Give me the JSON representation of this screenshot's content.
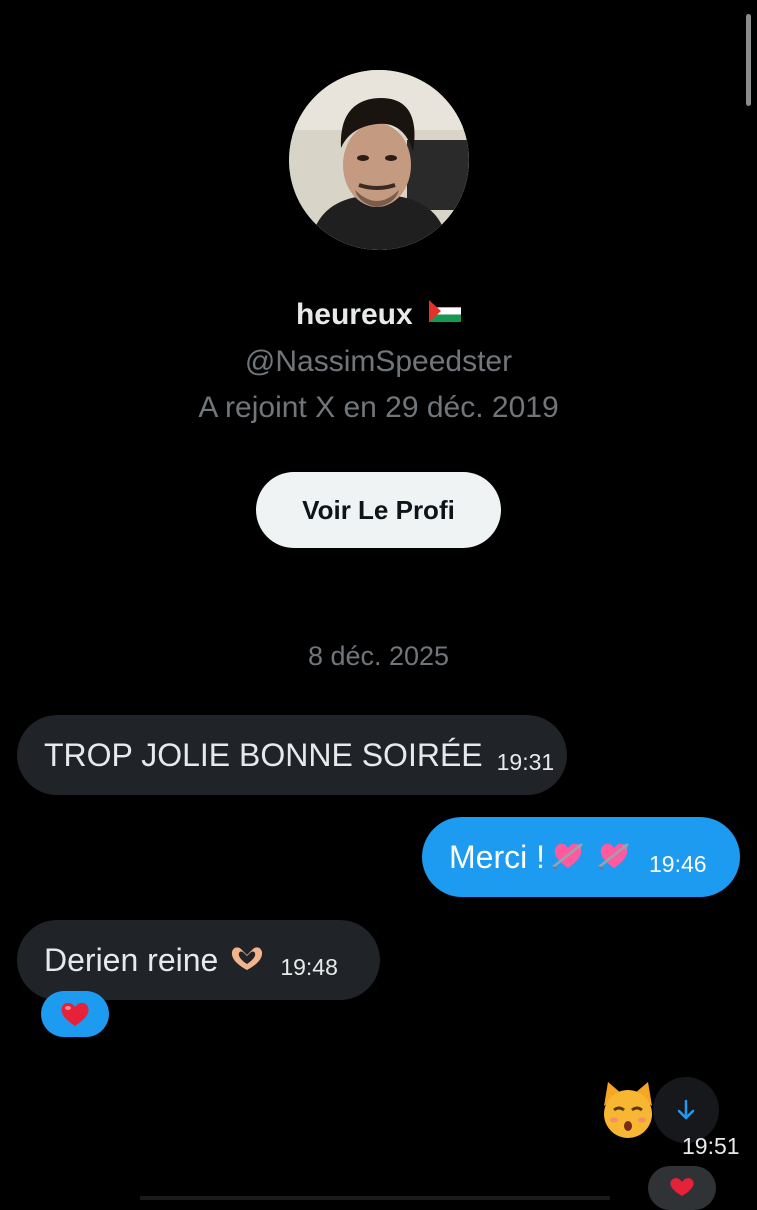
{
  "profile": {
    "display_name": "heureux",
    "flag_icon": "palestine-flag-icon",
    "handle": "@NassimSpeedster",
    "joined": "A rejoint X en 29 déc. 2019",
    "view_profile_label": "Voir Le Profi"
  },
  "conversation": {
    "date_separator": "8 déc. 2025",
    "messages": [
      {
        "direction": "incoming",
        "text": "TROP JOLIE BONNE SOIRÉE",
        "time": "19:31"
      },
      {
        "direction": "outgoing",
        "text": "Merci !",
        "emoji": [
          "heart-with-arrow-icon",
          "heart-with-arrow-icon"
        ],
        "time": "19:46"
      },
      {
        "direction": "incoming",
        "text": "Derien reine",
        "emoji": [
          "heart-hands-icon"
        ],
        "time": "19:48",
        "reaction": "red-heart-icon"
      },
      {
        "direction": "outgoing",
        "emoji": [
          "kissing-cat-icon"
        ],
        "time": "19:51"
      }
    ]
  },
  "colors": {
    "background": "#000000",
    "outgoing_bubble": "#1d9bf0",
    "incoming_bubble": "#202327",
    "secondary_text": "#71767b"
  },
  "scroll_down_icon": "arrow-down-icon"
}
